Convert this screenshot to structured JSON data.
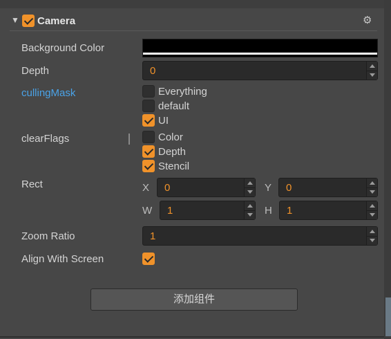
{
  "component": {
    "title": "Camera",
    "enabled": true
  },
  "properties": {
    "background_color": {
      "label": "Background Color",
      "value": "#000000"
    },
    "depth": {
      "label": "Depth",
      "value": "0"
    },
    "culling_mask": {
      "label": "cullingMask",
      "options": [
        {
          "label": "Everything",
          "checked": false
        },
        {
          "label": "default",
          "checked": false
        },
        {
          "label": "UI",
          "checked": true
        }
      ]
    },
    "clear_flags": {
      "label": "clearFlags",
      "options": [
        {
          "label": "Color",
          "checked": false
        },
        {
          "label": "Depth",
          "checked": true
        },
        {
          "label": "Stencil",
          "checked": true
        }
      ]
    },
    "rect": {
      "label": "Rect",
      "x_label": "X",
      "x": "0",
      "y_label": "Y",
      "y": "0",
      "w_label": "W",
      "w": "1",
      "h_label": "H",
      "h": "1"
    },
    "zoom_ratio": {
      "label": "Zoom Ratio",
      "value": "1"
    },
    "align_with_screen": {
      "label": "Align With Screen",
      "checked": true
    }
  },
  "add_component_label": "添加组件",
  "colors": {
    "accent": "#f0922a",
    "link_label": "#4aa3e8",
    "panel": "#474747"
  }
}
